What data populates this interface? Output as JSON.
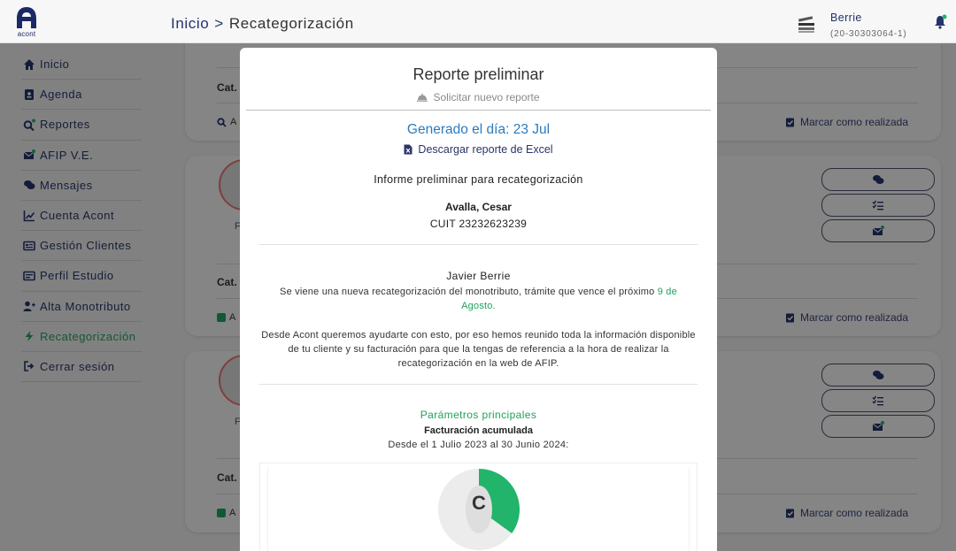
{
  "app": {
    "logo_text": "acont"
  },
  "breadcrumb": {
    "home": "Inicio",
    "separator": ">",
    "current": "Recategorización"
  },
  "user": {
    "name": "Berrie",
    "cuit": "(20-30303064-1)"
  },
  "sidebar": {
    "items": [
      {
        "label": "Inicio",
        "icon": "home-icon",
        "active": false
      },
      {
        "label": "Agenda",
        "icon": "agenda-icon",
        "active": false
      },
      {
        "label": "Reportes",
        "icon": "search-report-icon",
        "active": false
      },
      {
        "label": "AFIP V.E.",
        "icon": "envelope-icon",
        "active": false
      },
      {
        "label": "Mensajes",
        "icon": "chat-icon",
        "active": false
      },
      {
        "label": "Cuenta Acont",
        "icon": "chart-line-icon",
        "active": false
      },
      {
        "label": "Gestión Clientes",
        "icon": "id-card-icon",
        "active": false
      },
      {
        "label": "Perfil Estudio",
        "icon": "profile-card-icon",
        "active": false
      },
      {
        "label": "Alta Monotributo",
        "icon": "user-plus-icon",
        "active": false
      },
      {
        "label": "Recategorización",
        "icon": "bolt-icon",
        "active": true
      },
      {
        "label": "Cerrar sesión",
        "icon": "logout-icon",
        "active": false
      }
    ]
  },
  "background_cards": {
    "cat_label": "Cat.",
    "a_label": "A",
    "f_label": "F",
    "mark_done_label": "Marcar como realizada"
  },
  "modal": {
    "title": "Reporte preliminar",
    "request_new": "Solicitar nuevo reporte",
    "generated": "Generado el día: 23 Jul",
    "download": "Descargar reporte de Excel",
    "informe": "Informe preliminar para recategorización",
    "client_name": "Avalla, Cesar",
    "client_cuit": "CUIT 23232623239",
    "greeting": "Javier Berrie",
    "paragraph1_prefix": "Se viene una nueva recategorización del monotributo, trámite que vence el próximo ",
    "paragraph1_date": "9 de Agosto",
    "paragraph1_suffix": ".",
    "paragraph2": "Desde Acont queremos ayudarte con esto, por eso hemos reunido toda la información disponible de tu cliente y su facturación para que la tengas de referencia a la hora de realizar la recategorización en la web de AFIP.",
    "params_title": "Parámetros principales",
    "billing_title": "Facturación acumulada",
    "billing_range": "Desde el 1 Julio 2023 al 30 Junio 2024:",
    "chart_letter": "C"
  },
  "chart_data": {
    "type": "pie",
    "categories": [
      "",
      ""
    ],
    "values": [
      35,
      65
    ],
    "colors": [
      "#21b46a",
      "#ececec"
    ]
  },
  "colors": {
    "brand_navy": "#24336b",
    "accent_green": "#21a05b",
    "link_blue": "#2b7bbf"
  }
}
